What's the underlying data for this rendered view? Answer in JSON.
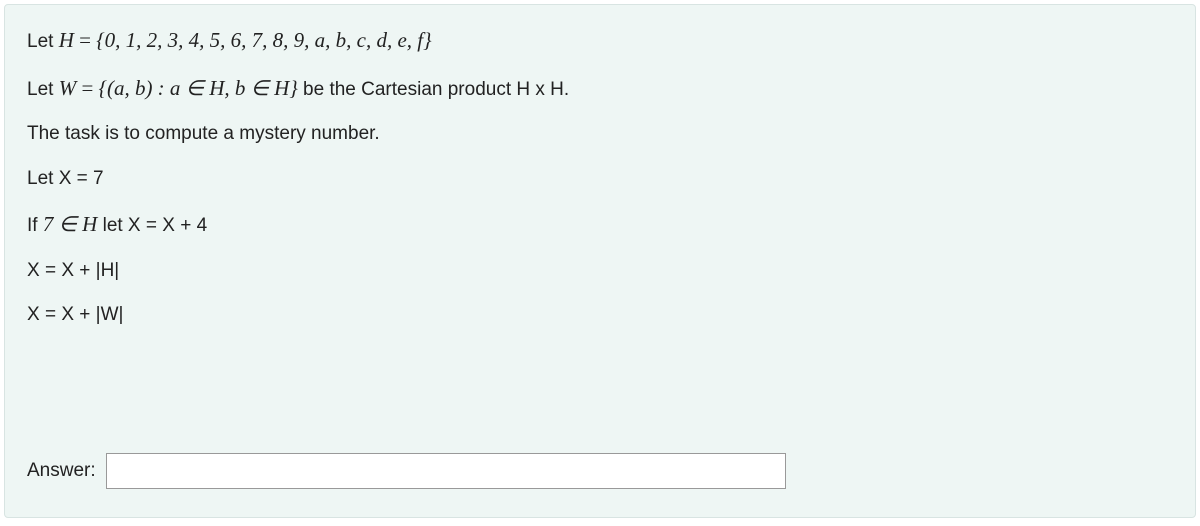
{
  "problem": {
    "line1_prefix": "Let ",
    "line1_H": "H",
    "line1_eq": " = ",
    "line1_set": "{0, 1, 2, 3, 4, 5, 6, 7, 8, 9, a, b, c, d, e, f}",
    "line2_prefix": "Let ",
    "line2_W": "W",
    "line2_eq": " = ",
    "line2_set": "{(a, b) : a ∈ H, b ∈ H}",
    "line2_suffix": " be the Cartesian product H x H.",
    "line3": "The task is to compute a mystery number.",
    "line4": "Let X = 7",
    "line5_prefix": "If ",
    "line5_cond": "7 ∈ H",
    "line5_suffix": " let X = X + 4",
    "line6": "X = X + |H|",
    "line7": "X = X + |W|",
    "answer_label": "Answer:",
    "answer_value": ""
  }
}
